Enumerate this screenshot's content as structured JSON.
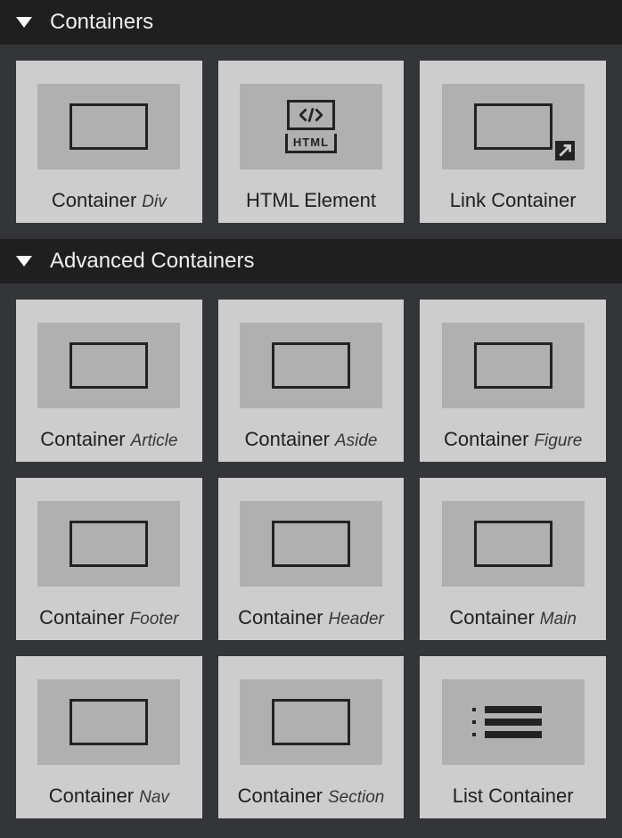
{
  "sections": {
    "containers": {
      "title": "Containers",
      "items": [
        {
          "label": "Container",
          "sub": "Div",
          "icon": "rect"
        },
        {
          "label": "HTML Element",
          "sub": "",
          "icon": "html"
        },
        {
          "label": "Link Container",
          "sub": "",
          "icon": "linkrect"
        }
      ]
    },
    "advanced": {
      "title": "Advanced Containers",
      "items": [
        {
          "label": "Container",
          "sub": "Article",
          "icon": "rect"
        },
        {
          "label": "Container",
          "sub": "Aside",
          "icon": "rect"
        },
        {
          "label": "Container",
          "sub": "Figure",
          "icon": "rect"
        },
        {
          "label": "Container",
          "sub": "Footer",
          "icon": "rect"
        },
        {
          "label": "Container",
          "sub": "Header",
          "icon": "rect"
        },
        {
          "label": "Container",
          "sub": "Main",
          "icon": "rect"
        },
        {
          "label": "Container",
          "sub": "Nav",
          "icon": "rect"
        },
        {
          "label": "Container",
          "sub": "Section",
          "icon": "rect"
        },
        {
          "label": "List Container",
          "sub": "",
          "icon": "list"
        }
      ]
    }
  }
}
